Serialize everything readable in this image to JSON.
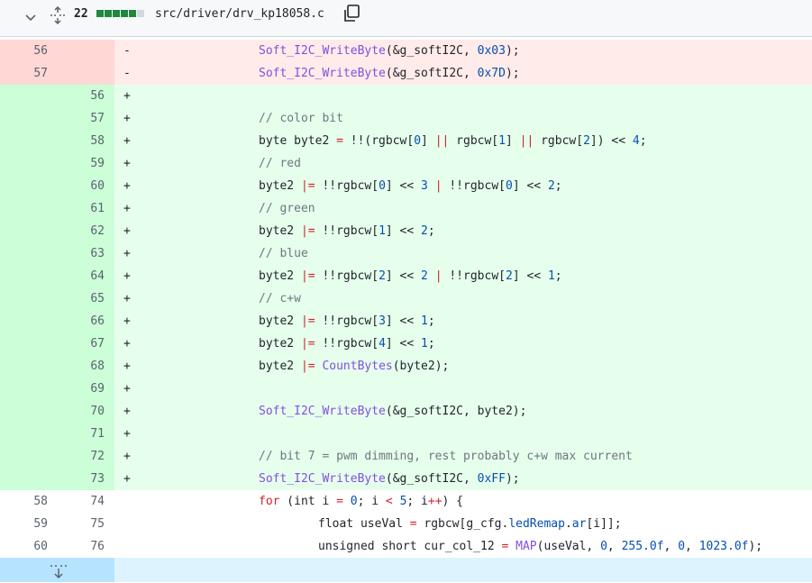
{
  "header": {
    "changes_count": "22",
    "filename": "src/driver/drv_kp18058.c",
    "stat_blocks": [
      "add",
      "add",
      "add",
      "add",
      "add",
      "neutral"
    ],
    "colors": {
      "add": "#1f883d",
      "neutral": "#d1d9e0"
    }
  },
  "icons": {
    "collapse": "chevron-down-icon",
    "expand_all": "unfold-icon",
    "copy": "copy-icon",
    "expand_down": "fold-down-icon"
  },
  "lines": [
    {
      "type": "del",
      "old": "56",
      "new": "",
      "sign": "-",
      "indent": "",
      "code": [
        [
          "fn",
          "Soft_I2C_WriteByte"
        ],
        [
          "pl",
          "(&g_softI2C, "
        ],
        [
          "num-lit",
          "0x03"
        ],
        [
          "pl",
          ");"
        ]
      ]
    },
    {
      "type": "del",
      "old": "57",
      "new": "",
      "sign": "-",
      "indent": "",
      "code": [
        [
          "fn",
          "Soft_I2C_WriteByte"
        ],
        [
          "pl",
          "(&g_softI2C, "
        ],
        [
          "num-lit",
          "0x7D"
        ],
        [
          "pl",
          ");"
        ]
      ]
    },
    {
      "type": "add",
      "old": "",
      "new": "56",
      "sign": "+",
      "code": []
    },
    {
      "type": "add",
      "old": "",
      "new": "57",
      "sign": "+",
      "code": [
        [
          "cm",
          "// color bit"
        ]
      ]
    },
    {
      "type": "add",
      "old": "",
      "new": "58",
      "sign": "+",
      "code": [
        [
          "pl",
          "byte byte2 "
        ],
        [
          "kw",
          "="
        ],
        [
          "pl",
          " !!(rgbcw["
        ],
        [
          "num-lit",
          "0"
        ],
        [
          "pl",
          "] "
        ],
        [
          "kw",
          "||"
        ],
        [
          "pl",
          " rgbcw["
        ],
        [
          "num-lit",
          "1"
        ],
        [
          "pl",
          "] "
        ],
        [
          "kw",
          "||"
        ],
        [
          "pl",
          " rgbcw["
        ],
        [
          "num-lit",
          "2"
        ],
        [
          "pl",
          "]) << "
        ],
        [
          "num-lit",
          "4"
        ],
        [
          "pl",
          ";"
        ]
      ]
    },
    {
      "type": "add",
      "old": "",
      "new": "59",
      "sign": "+",
      "code": [
        [
          "cm",
          "// red"
        ]
      ]
    },
    {
      "type": "add",
      "old": "",
      "new": "60",
      "sign": "+",
      "code": [
        [
          "pl",
          "byte2 "
        ],
        [
          "kw",
          "|="
        ],
        [
          "pl",
          " !!rgbcw["
        ],
        [
          "num-lit",
          "0"
        ],
        [
          "pl",
          "] << "
        ],
        [
          "num-lit",
          "3"
        ],
        [
          "pl",
          " "
        ],
        [
          "kw",
          "|"
        ],
        [
          "pl",
          " !!rgbcw["
        ],
        [
          "num-lit",
          "0"
        ],
        [
          "pl",
          "] << "
        ],
        [
          "num-lit",
          "2"
        ],
        [
          "pl",
          ";"
        ]
      ]
    },
    {
      "type": "add",
      "old": "",
      "new": "61",
      "sign": "+",
      "code": [
        [
          "cm",
          "// green"
        ]
      ]
    },
    {
      "type": "add",
      "old": "",
      "new": "62",
      "sign": "+",
      "code": [
        [
          "pl",
          "byte2 "
        ],
        [
          "kw",
          "|="
        ],
        [
          "pl",
          " !!rgbcw["
        ],
        [
          "num-lit",
          "1"
        ],
        [
          "pl",
          "] << "
        ],
        [
          "num-lit",
          "2"
        ],
        [
          "pl",
          ";"
        ]
      ]
    },
    {
      "type": "add",
      "old": "",
      "new": "63",
      "sign": "+",
      "code": [
        [
          "cm",
          "// blue"
        ]
      ]
    },
    {
      "type": "add",
      "old": "",
      "new": "64",
      "sign": "+",
      "code": [
        [
          "pl",
          "byte2 "
        ],
        [
          "kw",
          "|="
        ],
        [
          "pl",
          " !!rgbcw["
        ],
        [
          "num-lit",
          "2"
        ],
        [
          "pl",
          "] << "
        ],
        [
          "num-lit",
          "2"
        ],
        [
          "pl",
          " "
        ],
        [
          "kw",
          "|"
        ],
        [
          "pl",
          " !!rgbcw["
        ],
        [
          "num-lit",
          "2"
        ],
        [
          "pl",
          "] << "
        ],
        [
          "num-lit",
          "1"
        ],
        [
          "pl",
          ";"
        ]
      ]
    },
    {
      "type": "add",
      "old": "",
      "new": "65",
      "sign": "+",
      "code": [
        [
          "cm",
          "// c+w"
        ]
      ]
    },
    {
      "type": "add",
      "old": "",
      "new": "66",
      "sign": "+",
      "code": [
        [
          "pl",
          "byte2 "
        ],
        [
          "kw",
          "|="
        ],
        [
          "pl",
          " !!rgbcw["
        ],
        [
          "num-lit",
          "3"
        ],
        [
          "pl",
          "] << "
        ],
        [
          "num-lit",
          "1"
        ],
        [
          "pl",
          ";"
        ]
      ]
    },
    {
      "type": "add",
      "old": "",
      "new": "67",
      "sign": "+",
      "code": [
        [
          "pl",
          "byte2 "
        ],
        [
          "kw",
          "|="
        ],
        [
          "pl",
          " !!rgbcw["
        ],
        [
          "num-lit",
          "4"
        ],
        [
          "pl",
          "] << "
        ],
        [
          "num-lit",
          "1"
        ],
        [
          "pl",
          ";"
        ]
      ]
    },
    {
      "type": "add",
      "old": "",
      "new": "68",
      "sign": "+",
      "code": [
        [
          "pl",
          "byte2 "
        ],
        [
          "kw",
          "|="
        ],
        [
          "pl",
          " "
        ],
        [
          "fn",
          "CountBytes"
        ],
        [
          "pl",
          "(byte2);"
        ]
      ]
    },
    {
      "type": "add",
      "old": "",
      "new": "69",
      "sign": "+",
      "code": []
    },
    {
      "type": "add",
      "old": "",
      "new": "70",
      "sign": "+",
      "code": [
        [
          "fn",
          "Soft_I2C_WriteByte"
        ],
        [
          "pl",
          "(&g_softI2C, byte2);"
        ]
      ]
    },
    {
      "type": "add",
      "old": "",
      "new": "71",
      "sign": "+",
      "code": []
    },
    {
      "type": "add",
      "old": "",
      "new": "72",
      "sign": "+",
      "code": [
        [
          "cm",
          "// bit 7 = pwm dimming, rest probably c+w max current"
        ]
      ]
    },
    {
      "type": "add",
      "old": "",
      "new": "73",
      "sign": "+",
      "code": [
        [
          "fn",
          "Soft_I2C_WriteByte"
        ],
        [
          "pl",
          "(&g_softI2C, "
        ],
        [
          "num-lit",
          "0xFF"
        ],
        [
          "pl",
          ");"
        ]
      ]
    },
    {
      "type": "ctx",
      "old": "58",
      "new": "74",
      "sign": "",
      "code": [
        [
          "kw",
          "for"
        ],
        [
          "pl",
          " (int i "
        ],
        [
          "kw",
          "="
        ],
        [
          "pl",
          " "
        ],
        [
          "num-lit",
          "0"
        ],
        [
          "pl",
          "; i "
        ],
        [
          "kw",
          "<"
        ],
        [
          "pl",
          " "
        ],
        [
          "num-lit",
          "5"
        ],
        [
          "pl",
          "; i"
        ],
        [
          "kw",
          "++"
        ],
        [
          "pl",
          ") {"
        ]
      ]
    },
    {
      "type": "ctx",
      "old": "59",
      "new": "75",
      "sign": "",
      "extra": 1,
      "code": [
        [
          "pl",
          "float useVal "
        ],
        [
          "kw",
          "="
        ],
        [
          "pl",
          " rgbcw[g_cfg."
        ],
        [
          "var",
          "ledRemap"
        ],
        [
          "pl",
          "."
        ],
        [
          "var",
          "ar"
        ],
        [
          "pl",
          "[i]];"
        ]
      ]
    },
    {
      "type": "ctx",
      "old": "60",
      "new": "76",
      "sign": "",
      "extra": 1,
      "code": [
        [
          "pl",
          "unsigned short cur_col_12 "
        ],
        [
          "kw",
          "="
        ],
        [
          "pl",
          " "
        ],
        [
          "fn",
          "MAP"
        ],
        [
          "pl",
          "(useVal, "
        ],
        [
          "num-lit",
          "0"
        ],
        [
          "pl",
          ", "
        ],
        [
          "num-lit",
          "255.0f"
        ],
        [
          "pl",
          ", "
        ],
        [
          "num-lit",
          "0"
        ],
        [
          "pl",
          ", "
        ],
        [
          "num-lit",
          "1023.0f"
        ],
        [
          "pl",
          ");"
        ]
      ]
    }
  ]
}
